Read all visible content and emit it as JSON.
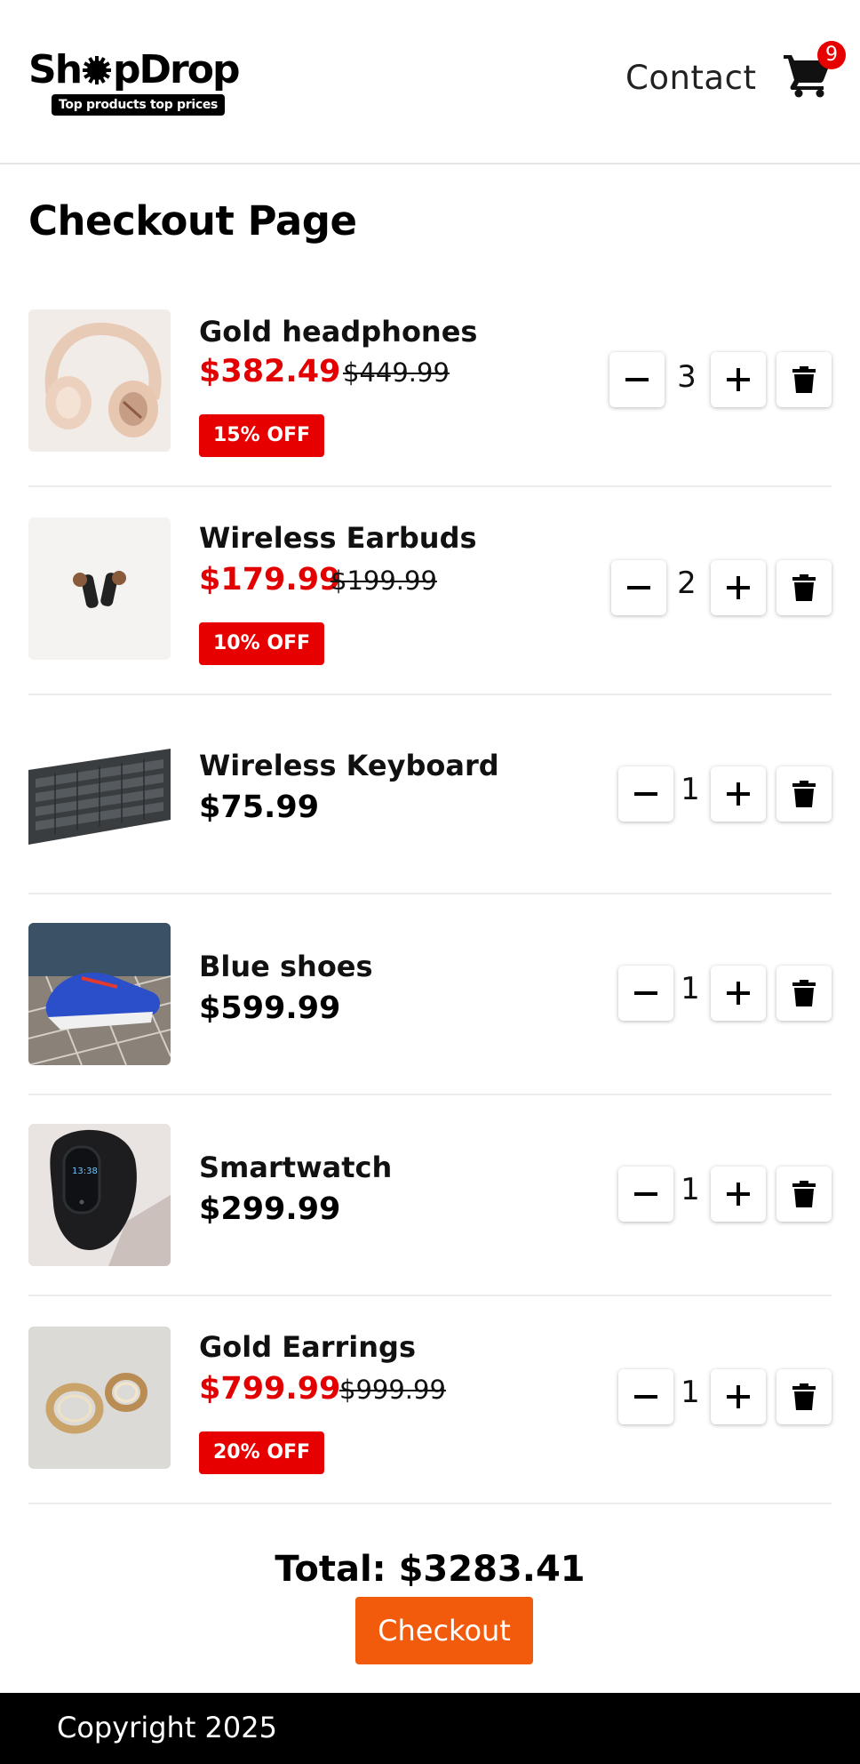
{
  "header": {
    "logo_text_1": "Sh",
    "logo_text_2": "pDrop",
    "tagline": "Top products top prices",
    "contact_label": "Contact",
    "cart_count": "9"
  },
  "page": {
    "title": "Checkout Page"
  },
  "items": [
    {
      "name": "Gold headphones",
      "price": "$382.49",
      "old_price": "$449.99",
      "discount": "15% OFF",
      "qty": "3"
    },
    {
      "name": "Wireless Earbuds",
      "price": "$179.99",
      "old_price": "$199.99",
      "discount": "10% OFF",
      "qty": "2"
    },
    {
      "name": "Wireless Keyboard",
      "price": "$75.99",
      "qty": "1"
    },
    {
      "name": "Blue shoes",
      "price": "$599.99",
      "qty": "1"
    },
    {
      "name": "Smartwatch",
      "price": "$299.99",
      "qty": "1"
    },
    {
      "name": "Gold Earrings",
      "price": "$799.99",
      "old_price": "$999.99",
      "discount": "20% OFF",
      "qty": "1"
    }
  ],
  "summary": {
    "total": "Total: $3283.41",
    "checkout_label": "Checkout"
  },
  "footer": {
    "copyright": "Copyright 2025"
  },
  "colors": {
    "sale_red": "#e30000",
    "badge_red": "#e60000",
    "checkout_orange": "#f25a0c",
    "footer_bg": "#000000"
  }
}
